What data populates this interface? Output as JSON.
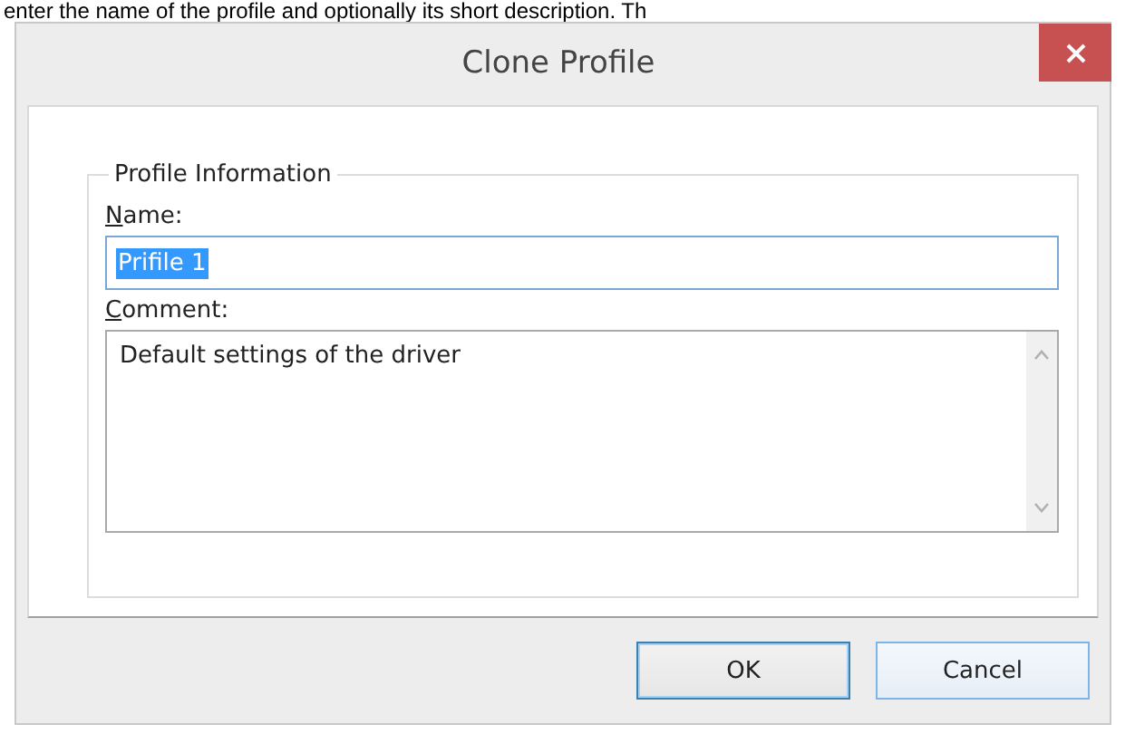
{
  "caption": "enter the name of the profile and optionally its short description. Th",
  "window": {
    "title": "Clone Profile"
  },
  "group": {
    "title": "Profile Information"
  },
  "fields": [
    {
      "kind": "line",
      "mnemonic": "N",
      "rest": "ame:",
      "value": "Prifile 1",
      "selected": true
    },
    {
      "kind": "multiline",
      "mnemonic": "C",
      "rest": "omment:",
      "value": "Default settings of the driver",
      "selected": false
    }
  ],
  "buttons": [
    {
      "label": "OK",
      "default": true
    },
    {
      "label": "Cancel",
      "default": false
    }
  ]
}
